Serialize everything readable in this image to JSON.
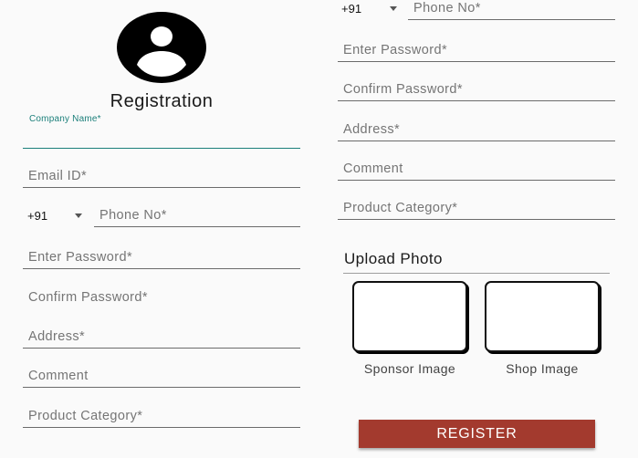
{
  "header": {
    "title": "Registration"
  },
  "left": {
    "company_name_label": "Company Name*",
    "email_placeholder": "Email ID*",
    "country_code": "+91",
    "phone_placeholder": "Phone No*",
    "password_placeholder": "Enter Password*",
    "confirm_password_placeholder": "Confirm Password*",
    "address_placeholder": "Address*",
    "comment_placeholder": "Comment",
    "product_category_placeholder": "Product Category*"
  },
  "right": {
    "country_code": "+91",
    "phone_placeholder": "Phone No*",
    "password_placeholder": "Enter Password*",
    "confirm_password_placeholder": "Confirm Password*",
    "address_placeholder": "Address*",
    "comment_placeholder": "Comment",
    "product_category_placeholder": "Product Category*",
    "upload_title": "Upload Photo",
    "sponsor_image_label": "Sponsor Image",
    "shop_image_label": "Shop Image",
    "register_label": "REGISTER"
  },
  "colors": {
    "accent": "#1b7f7a",
    "register_button": "#a33a2e"
  },
  "icons": {
    "avatar": "account-circle-icon",
    "dropdown": "arrow-drop-down-icon"
  }
}
